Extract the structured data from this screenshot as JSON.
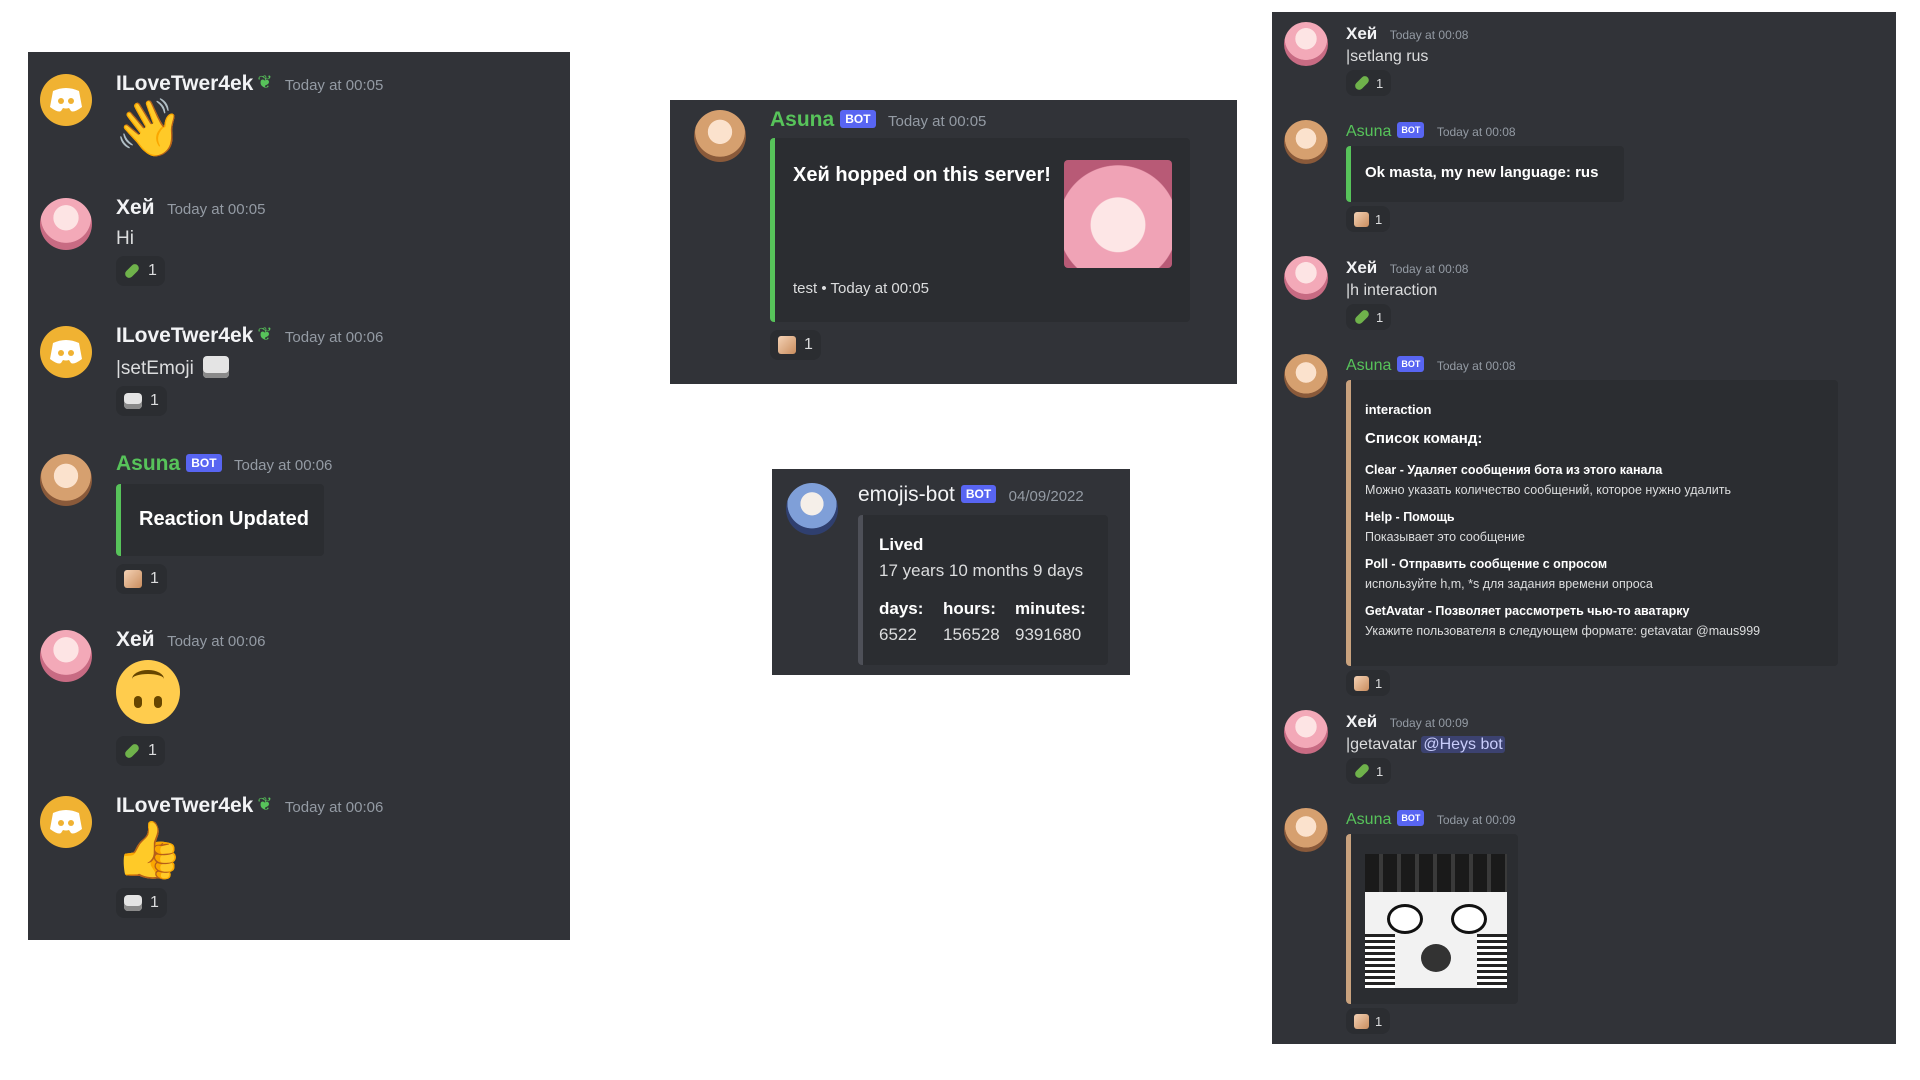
{
  "panel1": {
    "messages": [
      {
        "author": "ILoveTwer4ek",
        "time": "Today at 00:05",
        "reactions": []
      },
      {
        "author": "Хей",
        "time": "Today at 00:05",
        "text": "Hi",
        "reaction_count": "1"
      },
      {
        "author": "ILoveTwer4ek",
        "time": "Today at 00:06",
        "text": "|setEmoji",
        "reaction_count": "1"
      },
      {
        "author": "Asuna",
        "bot_tag": "BOT",
        "time": "Today at 00:06",
        "embed_title": "Reaction Updated",
        "reaction_count": "1"
      },
      {
        "author": "Хей",
        "time": "Today at 00:06",
        "reaction_count": "1"
      },
      {
        "author": "ILoveTwer4ek",
        "time": "Today at 00:06",
        "reaction_count": "1"
      }
    ]
  },
  "panel2": {
    "author": "Asuna",
    "bot_tag": "BOT",
    "time": "Today at 00:05",
    "embed_title": "Хей hopped on this server!",
    "footer_name": "test",
    "footer_sep": "•",
    "footer_time": "Today at 00:05",
    "reaction_count": "1"
  },
  "panel3": {
    "author": "emojis-bot",
    "bot_tag": "BOT",
    "time": "04/09/2022",
    "field_lived_name": "Lived",
    "field_lived_value": "17 years 10 months 9 days",
    "fields": [
      {
        "name": "days:",
        "value": "6522"
      },
      {
        "name": "hours:",
        "value": "156528"
      },
      {
        "name": "minutes:",
        "value": "9391680"
      }
    ]
  },
  "panel4": {
    "messages": [
      {
        "author": "Хей",
        "time": "Today at 00:08",
        "text": "|setlang rus",
        "reaction_count": "1"
      },
      {
        "author": "Asuna",
        "bot_tag": "BOT",
        "time": "Today at 00:08",
        "embed_title": "Ok masta, my new language: rus",
        "reaction_count": "1"
      },
      {
        "author": "Хей",
        "time": "Today at 00:08",
        "text": "|h interaction",
        "reaction_count": "1"
      },
      {
        "author": "Asuna",
        "bot_tag": "BOT",
        "time": "Today at 00:08",
        "reaction_count": "1",
        "embed_heading": "interaction",
        "embed_subheading": "Список команд:",
        "commands": [
          {
            "title": "Clear - Удаляет сообщения бота из этого канала",
            "desc": "Можно указать количество сообщений, которое нужно удалить"
          },
          {
            "title": "Help - Помощь",
            "desc": "Показывает это сообщение"
          },
          {
            "title": "Poll - Отправить сообщение с опросом",
            "desc": "используйте h,m, *s для задания времени опроса"
          },
          {
            "title": "GetAvatar - Позволяет рассмотреть чью-то аватарку",
            "desc": "Укажите пользователя в следующем формате: getavatar @maus999"
          }
        ]
      },
      {
        "author": "Хей",
        "time": "Today at 00:09",
        "text": "|getavatar",
        "mention": "@Heys bot",
        "reaction_count": "1"
      },
      {
        "author": "Asuna",
        "bot_tag": "BOT",
        "time": "Today at 00:09",
        "reaction_count": "1"
      }
    ]
  },
  "colors": {
    "panel_bg": "#313338",
    "embed_bg": "#2b2d31",
    "bot_badge": "#5865f2",
    "green_name": "#57c35a",
    "accent_border": "#57c35a"
  }
}
